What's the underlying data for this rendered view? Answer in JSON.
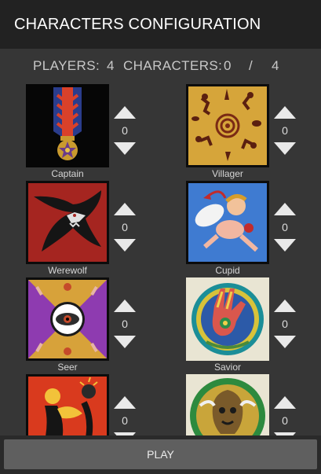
{
  "header": {
    "title": "CHARACTERS CONFIGURATION"
  },
  "summary": {
    "players_label": "PLAYERS:",
    "players_value": "4",
    "characters_label": "CHARACTERS:",
    "characters_selected": "0",
    "separator": "/",
    "characters_total": "4"
  },
  "characters": [
    {
      "name": "Captain",
      "count": "0",
      "icon": "captain-medal-icon"
    },
    {
      "name": "Villager",
      "count": "0",
      "icon": "villager-art-icon"
    },
    {
      "name": "Werewolf",
      "count": "0",
      "icon": "werewolf-art-icon"
    },
    {
      "name": "Cupid",
      "count": "0",
      "icon": "cupid-art-icon"
    },
    {
      "name": "Seer",
      "count": "0",
      "icon": "seer-eye-icon"
    },
    {
      "name": "Savior",
      "count": "0",
      "icon": "savior-hand-icon"
    },
    {
      "name": "",
      "count": "0",
      "icon": "witch-art-icon"
    },
    {
      "name": "",
      "count": "0",
      "icon": "tree-art-icon"
    }
  ],
  "footer": {
    "play_label": "PLAY"
  },
  "colors": {
    "titlebar": "#222222",
    "background": "#363636",
    "button": "#5f5f5f",
    "arrows": "#e9e9e9"
  }
}
